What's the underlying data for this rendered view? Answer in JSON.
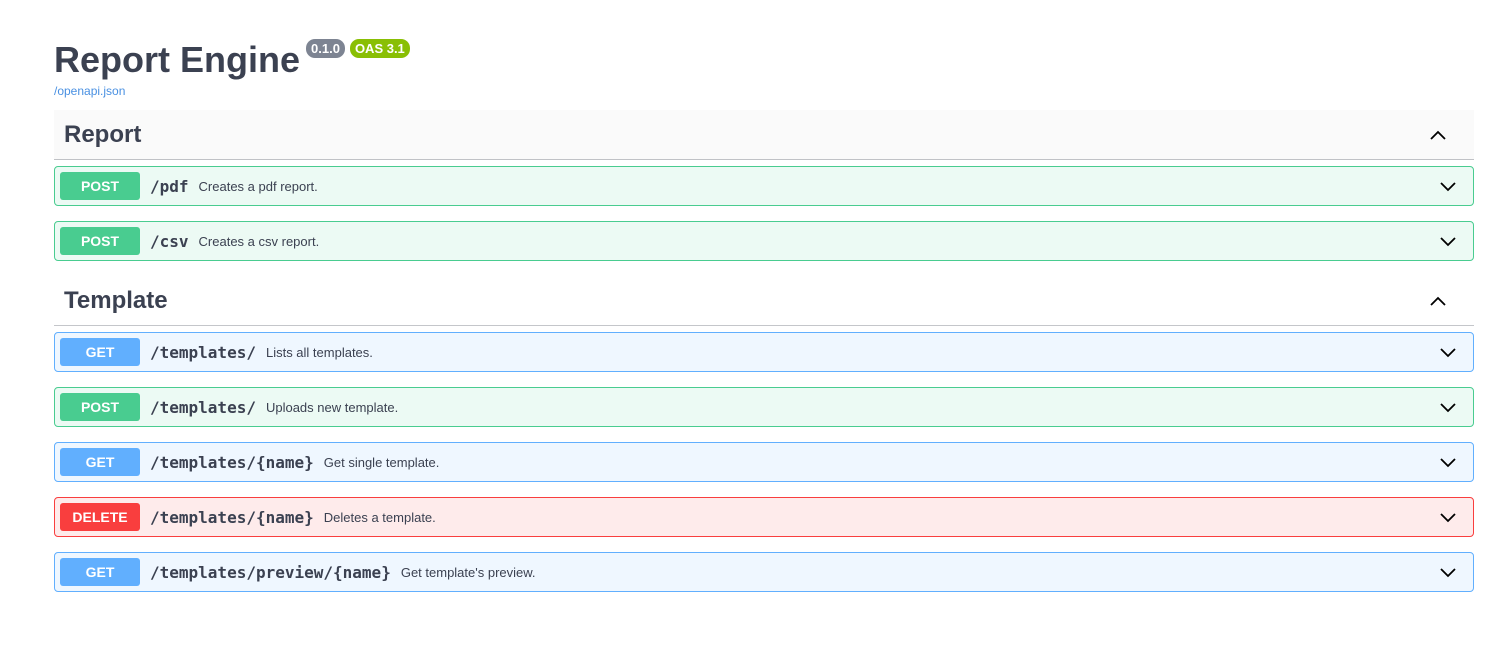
{
  "info": {
    "title": "Report Engine",
    "version": "0.1.0",
    "oas": "OAS 3.1",
    "spec_link": "/openapi.json"
  },
  "tags": [
    {
      "name": "Report",
      "operations": [
        {
          "method": "POST",
          "path": "/pdf",
          "summary": "Creates a pdf report."
        },
        {
          "method": "POST",
          "path": "/csv",
          "summary": "Creates a csv report."
        }
      ]
    },
    {
      "name": "Template",
      "operations": [
        {
          "method": "GET",
          "path": "/templates/",
          "summary": "Lists all templates."
        },
        {
          "method": "POST",
          "path": "/templates/",
          "summary": "Uploads new template."
        },
        {
          "method": "GET",
          "path": "/templates/{name}",
          "summary": "Get single template."
        },
        {
          "method": "DELETE",
          "path": "/templates/{name}",
          "summary": "Deletes a template."
        },
        {
          "method": "GET",
          "path": "/templates/preview/{name}",
          "summary": "Get template's preview."
        }
      ]
    }
  ],
  "icons": {
    "tag_toggle": "chevron-up-icon",
    "op_toggle": "chevron-down-icon"
  },
  "colors": {
    "post": "#49cc90",
    "get": "#61affe",
    "delete": "#f93e3e",
    "text": "#3b4151",
    "link": "#4990e2"
  }
}
